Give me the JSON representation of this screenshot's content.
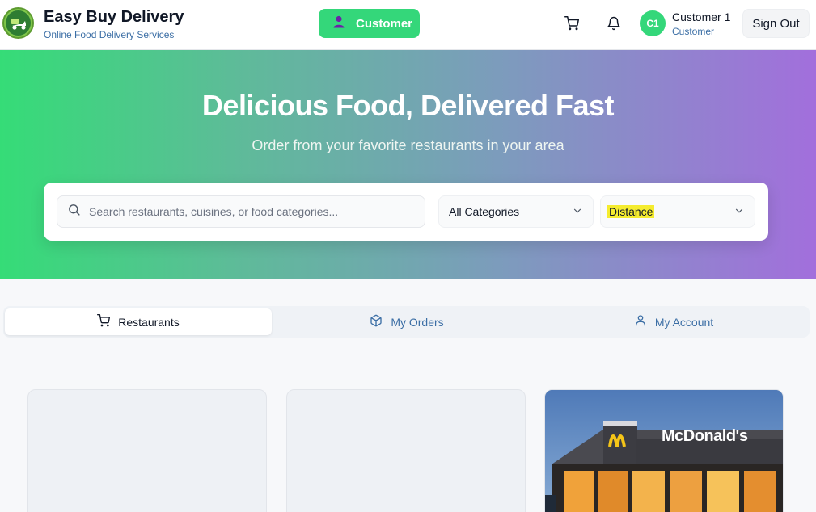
{
  "header": {
    "brand_title": "Easy Buy Delivery",
    "brand_subtitle": "Online Food Delivery Services",
    "logo_icon": "delivery-scooter-logo",
    "role_button_label": "Customer",
    "role_icon": "user-icon",
    "cart_icon": "cart-icon",
    "bell_icon": "bell-icon",
    "avatar_initials": "C1",
    "user_name": "Customer 1",
    "user_role": "Customer",
    "sign_out_label": "Sign Out"
  },
  "hero": {
    "title": "Delicious Food, Delivered Fast",
    "subtitle": "Order from your favorite restaurants in your area",
    "search": {
      "placeholder": "Search restaurants, cuisines, or food categories...",
      "value": ""
    },
    "category_select": {
      "selected": "All Categories"
    },
    "sort_select": {
      "selected": "Distance",
      "highlight_color": "#f5ec2f"
    }
  },
  "tabs": [
    {
      "label": "Restaurants",
      "icon": "cart-icon",
      "active": true
    },
    {
      "label": "My Orders",
      "icon": "package-icon",
      "active": false
    },
    {
      "label": "My Account",
      "icon": "user-icon",
      "active": false
    }
  ],
  "restaurants": [
    {
      "state": "loading"
    },
    {
      "state": "loading"
    },
    {
      "state": "image",
      "image_subject": "McDonald's storefront at dusk",
      "sign_text": "McDonald's"
    }
  ],
  "colors": {
    "accent_green": "#34d77a",
    "link_blue": "#3b6ea5",
    "hero_gradient_start": "#35dc77",
    "hero_gradient_end": "#a26fdc"
  }
}
